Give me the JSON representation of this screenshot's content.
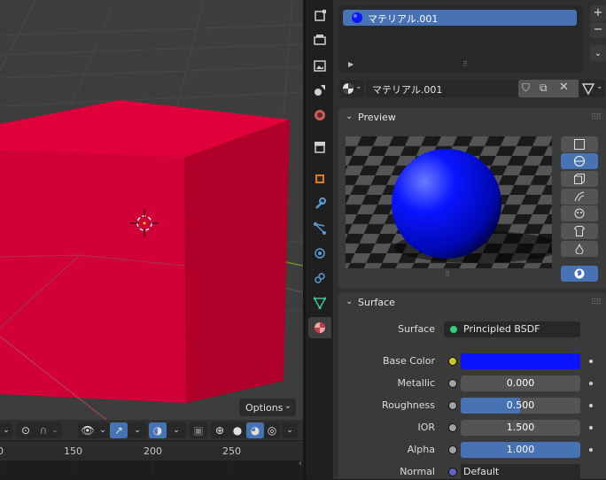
{
  "viewport": {
    "options_label": "Options",
    "colors": {
      "cube": "#d10036",
      "cube_shadow": "#8a0019",
      "background": "#3d3d3d",
      "x_axis": "#9d2b3a",
      "y_axis": "#6b8c1f"
    }
  },
  "timeline": {
    "ticks": [
      "0",
      "150",
      "200",
      "250"
    ]
  },
  "tabs": {
    "items": [
      {
        "icon": "tool-icon",
        "active": false
      },
      {
        "icon": "render-icon",
        "active": false
      },
      {
        "icon": "output-icon",
        "active": false
      },
      {
        "icon": "view-layer-icon",
        "active": false
      },
      {
        "icon": "scene-icon",
        "active": false
      },
      {
        "icon": "world-icon",
        "active": false
      },
      {
        "icon": "collection-icon",
        "active": false
      },
      {
        "icon": "object-icon",
        "active": false
      },
      {
        "icon": "modifier-wrench-icon",
        "active": false
      },
      {
        "icon": "particles-icon",
        "active": false
      },
      {
        "icon": "physics-icon",
        "active": false
      },
      {
        "icon": "constraints-icon",
        "active": false
      },
      {
        "icon": "object-data-icon",
        "active": false
      },
      {
        "icon": "material-icon",
        "active": true
      }
    ]
  },
  "material_slots": {
    "items": [
      {
        "name": "マテリアル.001",
        "selected": true
      }
    ]
  },
  "material_selector": {
    "name": "マテリアル.001"
  },
  "preview_panel": {
    "title": "Preview",
    "sphere_color": "#0a14ff",
    "shapes": [
      "flat-icon",
      "sphere-icon",
      "cube-icon",
      "hair-icon",
      "monkey-icon",
      "cloth-icon",
      "fluid-icon"
    ],
    "selected_shape": 1,
    "world_button": "world-icon"
  },
  "surface_panel": {
    "title": "Surface",
    "surface_label": "Surface",
    "surface_value": "Principled BSDF",
    "properties": [
      {
        "label": "Base Color",
        "type": "color",
        "color": "#0a14ff",
        "socket": "#c7c729"
      },
      {
        "label": "Metallic",
        "type": "number",
        "value": "0.000",
        "fraction": 0.0,
        "socket": "#a1a1a1"
      },
      {
        "label": "Roughness",
        "type": "number",
        "value": "0.500",
        "fraction": 0.5,
        "socket": "#a1a1a1"
      },
      {
        "label": "IOR",
        "type": "number",
        "value": "1.500",
        "fraction": 0.0,
        "socket": "#a1a1a1"
      },
      {
        "label": "Alpha",
        "type": "number",
        "value": "1.000",
        "fraction": 1.0,
        "socket": "#a1a1a1"
      },
      {
        "label": "Normal",
        "type": "dropdown",
        "value": "Default",
        "socket": "#6363c7"
      }
    ]
  }
}
